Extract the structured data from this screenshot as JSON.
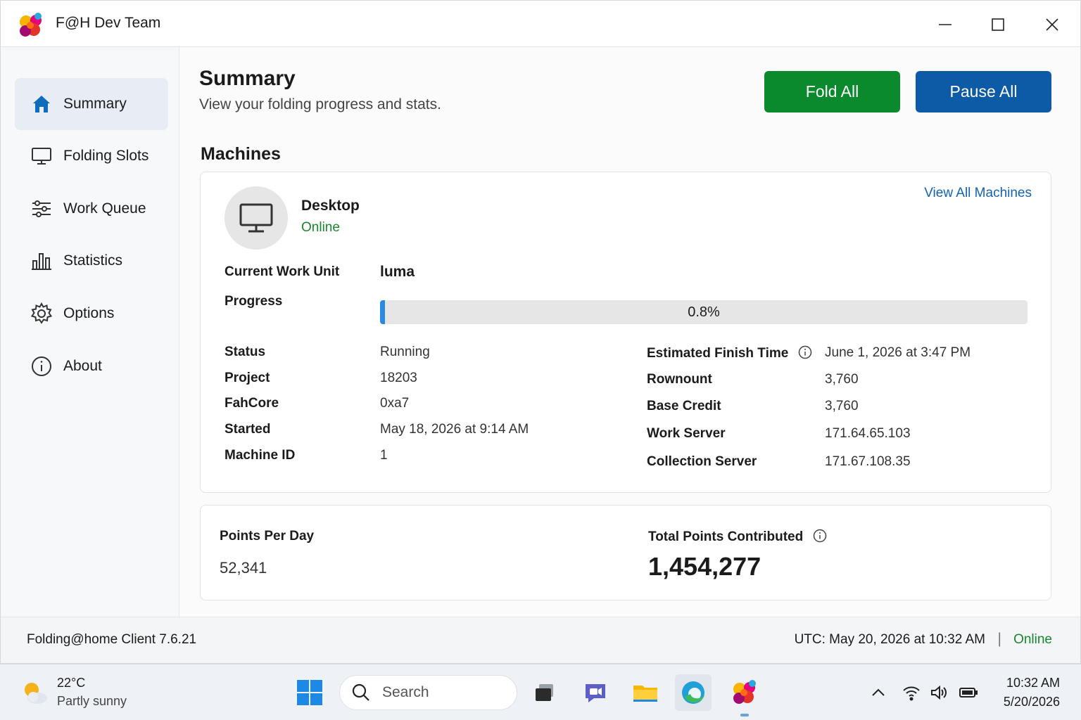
{
  "window": {
    "title": "F@H Dev Team",
    "minimize_icon": "minimize-icon",
    "maximize_icon": "maximize-icon",
    "close_icon": "close-icon"
  },
  "sidebar": {
    "items": [
      {
        "label": "Summary",
        "icon": "home-icon",
        "active": true
      },
      {
        "label": "Folding Slots",
        "icon": "monitor-icon"
      },
      {
        "label": "Work Queue",
        "icon": "sliders-icon"
      },
      {
        "label": "Statistics",
        "icon": "bar-chart-icon"
      },
      {
        "label": "Options",
        "icon": "gear-icon"
      },
      {
        "label": "About",
        "icon": "info-icon"
      }
    ]
  },
  "header": {
    "title": "Summary",
    "subtitle": "View your folding progress and stats.",
    "fold_all_label": "Fold All",
    "pause_all_label": "Pause All"
  },
  "machines": {
    "section_title": "Machines",
    "view_all_label": "View All Machines",
    "machine": {
      "name": "Desktop",
      "status": "Online",
      "current_work_unit_label": "Current Work Unit",
      "current_work_unit": "luma",
      "progress_label": "Progress",
      "progress_text": "0.8%",
      "progress_value": 0.008,
      "left_details": [
        {
          "label": "Status",
          "value": "Running"
        },
        {
          "label": "Project",
          "value": "18203"
        },
        {
          "label": "FahCore",
          "value": "0xa7"
        },
        {
          "label": "Started",
          "value": "May 18, 2026 at 9:14 AM"
        },
        {
          "label": "Machine ID",
          "value": "1"
        }
      ],
      "right_details": [
        {
          "label": "Estimated Finish Time",
          "value": "June 1, 2026 at 3:47 PM",
          "has_info": true
        },
        {
          "label": "Rownount",
          "value": "3,760"
        },
        {
          "label": "Base Credit",
          "value": "3,760"
        },
        {
          "label": "Work Server",
          "value": "171.64.65.103"
        },
        {
          "label": "Collection Server",
          "value": "171.67.108.35"
        }
      ]
    }
  },
  "points": {
    "ppd_label": "Points Per Day",
    "ppd_value": "52,341",
    "total_label": "Total Points Contributed",
    "total_value": "1,454,277"
  },
  "statusbar": {
    "client_version": "Folding@home Client 7.6.21",
    "utc": "UTC: May 20, 2026 at 10:32 AM",
    "separator": "|",
    "connection": "Online"
  },
  "taskbar": {
    "weather_temp": "22°C",
    "weather_desc": "Partly sunny",
    "search_placeholder": "Search",
    "clock_time": "10:32 AM",
    "clock_date": "5/20/2026"
  },
  "colors": {
    "accent_green": "#0b8a2d",
    "accent_blue": "#0d5aa7",
    "online_green": "#16882f",
    "progress_blue": "#2a8ae0",
    "link_blue": "#1462b5"
  }
}
